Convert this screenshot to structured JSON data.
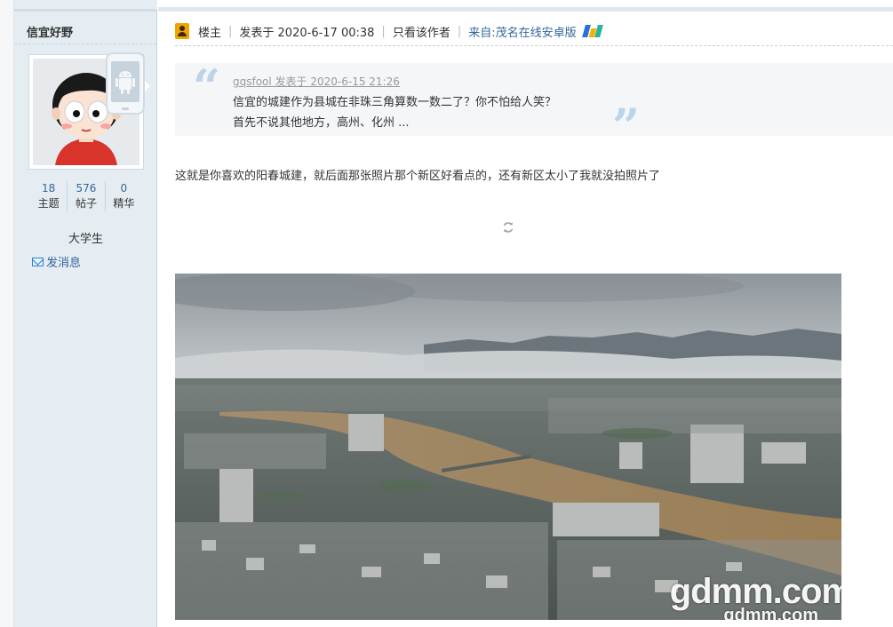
{
  "author": {
    "name": "信宜好野",
    "stats": [
      {
        "value": "18",
        "label": "主题"
      },
      {
        "value": "576",
        "label": "帖子"
      },
      {
        "value": "0",
        "label": "精华"
      }
    ],
    "usergroup": "大学生",
    "send_message": "发消息"
  },
  "post_meta": {
    "role": "楼主",
    "posted_at": "发表于 2020-6-17 00:38",
    "only_author": "只看该作者",
    "source": "来自:茂名在线安卓版"
  },
  "quote": {
    "header": "gqsfool 发表于 2020-6-15 21:26",
    "lines": [
      "信宜的城建作为县城在非珠三角算数一数二了？你不怕给人笑？",
      "首先不说其他地方，高州、化州 ..."
    ]
  },
  "post_body": "这就是你喜欢的阳春城建，就后面那张照片那个新区好看点的，还有新区太小了我就没拍照片了",
  "photo": {
    "watermark": "gdmm.com",
    "icons": [
      "android-phone-icon",
      "refresh-icon",
      "mail-icon",
      "author-badge-icon",
      "app-logo-icon"
    ]
  },
  "colors": {
    "link": "#336699",
    "sidebar_bg": "#e5edf2",
    "quote_mark": "#bcd4ea",
    "badge": "#f3a300"
  }
}
